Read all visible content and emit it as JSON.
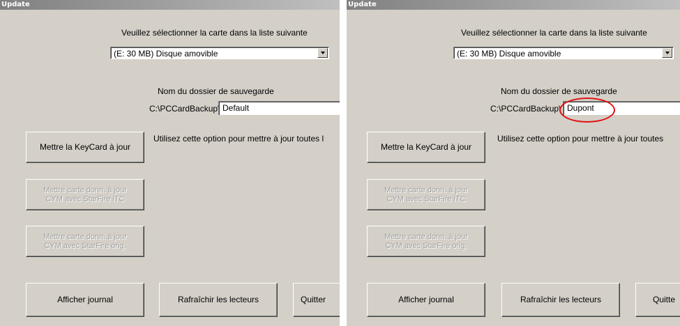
{
  "left": {
    "window_title": "Update",
    "instruction": "Veuillez sélectionner la carte dans la liste suivante",
    "drive_select": "(E: 30 MB) Disque amovible",
    "backup_label": "Nom du dossier de sauvegarde",
    "path_prefix": "C:\\PCCardBackup\\",
    "folder_value": "Default",
    "option_hint": "Utilisez cette option pour mettre à jour toutes l",
    "btn_keycard": "Mettre la KeyCard à jour",
    "btn_itc": "Mettre carte donn. à jour\nCYM avec StarFire iTC",
    "btn_orig": "Mettre carte donn. à jour\nCYM avec StarFire orig.",
    "btn_journal": "Afficher journal",
    "btn_refresh": "Rafraîchir les lecteurs",
    "btn_quit": "Quitter"
  },
  "right": {
    "window_title": "Update",
    "instruction": "Veuillez sélectionner la carte dans la liste suivante",
    "drive_select": "(E: 30 MB) Disque amovible",
    "backup_label": "Nom du dossier de sauvegarde",
    "path_prefix": "C:\\PCCardBackup\\",
    "folder_value": "Dupont",
    "option_hint": "Utilisez cette option pour mettre à jour toutes",
    "btn_keycard": "Mettre la KeyCard à jour",
    "btn_itc": "Mettre carte donn. à jour\nCYM avec StarFire iTC",
    "btn_orig": "Mettre carte donn. à jour\nCYM avec StarFire orig.",
    "btn_journal": "Afficher journal",
    "btn_refresh": "Rafraîchir les lecteurs",
    "btn_quit": "Quitte"
  },
  "colors": {
    "highlight_circle": "#e01010",
    "panel_bg": "#d4d0c8"
  }
}
